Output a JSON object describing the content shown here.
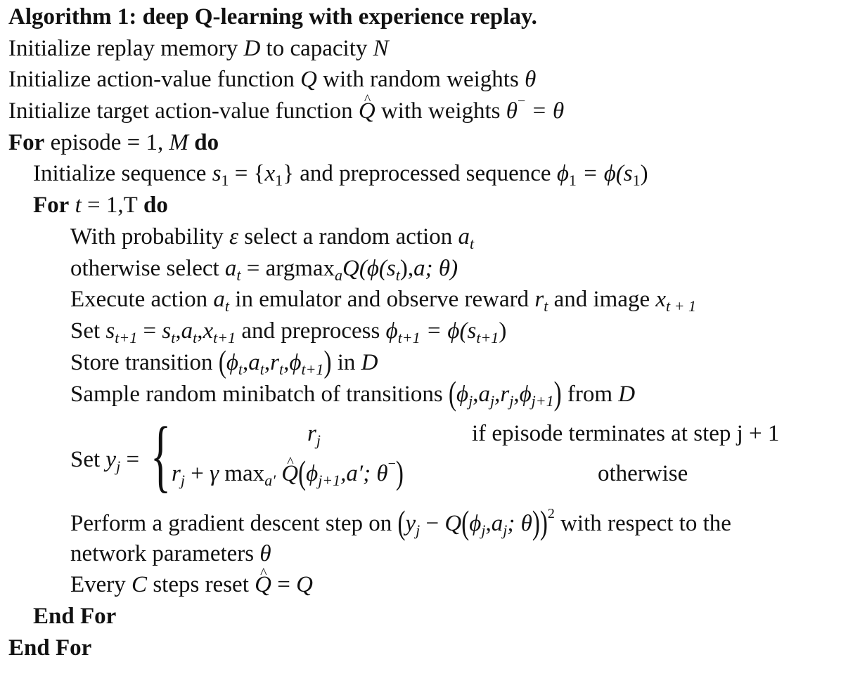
{
  "algorithm": {
    "title": "Algorithm 1: deep Q-learning with experience replay.",
    "lines": {
      "init_memory": {
        "pre": "Initialize replay memory ",
        "D": "D",
        "mid": " to capacity ",
        "N": "N"
      },
      "init_q": {
        "pre": "Initialize action-value function ",
        "Q": "Q",
        "mid": " with random weights ",
        "theta": "θ"
      },
      "init_target": {
        "pre": "Initialize target action-value function ",
        "Qhat": "Q",
        "mid": " with weights ",
        "eq": "θ",
        "minus": "−",
        "rest": " = θ"
      },
      "for_episode": {
        "kw": "For",
        "mid": " episode = 1, ",
        "M": "M",
        "do": " do"
      },
      "init_seq": {
        "pre": "Initialize sequence ",
        "s": "s",
        "s_sub": "1",
        "mid1": " = {",
        "x": "x",
        "x_sub": "1",
        "mid2": "} and preprocessed sequence ",
        "phi": "ϕ",
        "phi_sub": "1",
        "rest1": " = ϕ(",
        "s2": "s",
        "s2_sub": "1",
        "rest2": ")"
      },
      "for_t": {
        "kw": "For",
        "t": " t",
        "mid": " = 1,T",
        "do": " do"
      },
      "with_prob": {
        "pre": "With probability ",
        "eps": "ε",
        "mid": " select a random action ",
        "a": "a",
        "a_sub": "t"
      },
      "otherwise": {
        "pre": "otherwise select ",
        "a": "a",
        "a_sub": "t",
        "mid": " = argmax",
        "argsub": "a",
        "Q": "Q",
        "rest1": "(ϕ(",
        "s": "s",
        "s_sub": "t",
        "rest2": "),",
        "a2": "a",
        "rest3": "; θ)"
      },
      "execute": {
        "pre": "Execute action ",
        "a": "a",
        "a_sub": "t",
        "mid": " in emulator and observe reward ",
        "r": "r",
        "r_sub": "t",
        "mid2": " and image ",
        "x": "x",
        "x_sub": "t + 1"
      },
      "set_s": {
        "pre": "Set ",
        "s": "s",
        "s_sub": "t+1",
        "mid": " = ",
        "s2": "s",
        "s2_sub": "t",
        "c1": ",",
        "a": "a",
        "a_sub": "t",
        "c2": ",",
        "x": "x",
        "x_sub": "t+1",
        "mid2": " and preprocess ",
        "phi": "ϕ",
        "phi_sub": "t+1",
        "rest1": " = ϕ(",
        "s3": "s",
        "s3_sub": "t+1",
        "rest2": ")"
      },
      "store": {
        "pre": "Store transition ",
        "open": "(",
        "phi": "ϕ",
        "phi_sub": "t",
        "c1": ",",
        "a": "a",
        "a_sub": "t",
        "c2": ",",
        "r": "r",
        "r_sub": "t",
        "c3": ",",
        "phi2": "ϕ",
        "phi2_sub": "t+1",
        "close": ")",
        "mid": " in ",
        "D": "D"
      },
      "sample": {
        "pre": "Sample random minibatch of transitions ",
        "open": "(",
        "phi": "ϕ",
        "phi_sub": "j",
        "c1": ",",
        "a": "a",
        "a_sub": "j",
        "c2": ",",
        "r": "r",
        "r_sub": "j",
        "c3": ",",
        "phi2": "ϕ",
        "phi2_sub": "j+1",
        "close": ")",
        "mid": " from ",
        "D": "D"
      },
      "set_y": {
        "pre": "Set ",
        "y": "y",
        "y_sub": "j",
        "eq": " = ",
        "brace": "{",
        "case1_expr_r": "r",
        "case1_expr_sub": "j",
        "case1_cond": "if episode terminates at step j + 1",
        "case2_r": "r",
        "case2_r_sub": "j",
        "case2_plus": " + ",
        "case2_gamma": "γ",
        "case2_max": " max",
        "case2_max_sub": "a′",
        "case2_Qhat": "Q",
        "case2_open": "(",
        "case2_phi": "ϕ",
        "case2_phi_sub": "j+1",
        "case2_mid": ",a′; θ",
        "case2_minus": "−",
        "case2_close": ")",
        "case2_cond": "otherwise"
      },
      "gradient": {
        "pre": "Perform a gradient descent step on ",
        "open": "(",
        "y": "y",
        "y_sub": "j",
        "minus": " − ",
        "Q": "Q",
        "open2": "(",
        "phi": "ϕ",
        "phi_sub": "j",
        "c1": ",",
        "a": "a",
        "a_sub": "j",
        "rest": "; θ",
        "close2": ")",
        "close": ")",
        "sq": "2",
        "post": " with respect to the"
      },
      "gradient_cont": {
        "pre": "network parameters ",
        "theta": "θ"
      },
      "reset": {
        "pre": "Every ",
        "C": "C",
        "mid": " steps reset ",
        "Qhat": "Q",
        "eq": " = ",
        "Q": "Q"
      },
      "end_inner": "End For",
      "end_outer": "End For"
    }
  }
}
